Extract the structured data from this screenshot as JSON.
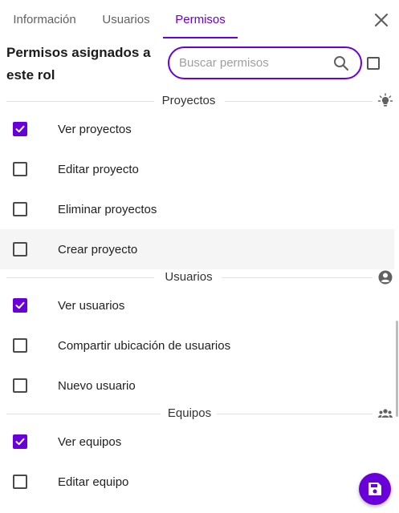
{
  "tabs": [
    {
      "label": "Información",
      "active": false
    },
    {
      "label": "Usuarios",
      "active": false
    },
    {
      "label": "Permisos",
      "active": true
    }
  ],
  "header": {
    "title": "Permisos asignados a este rol",
    "search_placeholder": "Buscar permisos",
    "search_value": ""
  },
  "sections": [
    {
      "label": "Proyectos",
      "icon": "lightbulb-icon",
      "items": [
        {
          "label": "Ver proyectos",
          "checked": true
        },
        {
          "label": "Editar proyecto",
          "checked": false
        },
        {
          "label": "Eliminar proyectos",
          "checked": false
        },
        {
          "label": "Crear proyecto",
          "checked": false
        }
      ]
    },
    {
      "label": "Usuarios",
      "icon": "user-circle-icon",
      "items": [
        {
          "label": "Ver usuarios",
          "checked": true
        },
        {
          "label": "Compartir ubicación de usuarios",
          "checked": false
        },
        {
          "label": "Nuevo usuario",
          "checked": false
        }
      ]
    },
    {
      "label": "Equipos",
      "icon": "group-icon",
      "items": [
        {
          "label": "Ver equipos",
          "checked": true
        },
        {
          "label": "Editar equipo",
          "checked": false
        }
      ]
    }
  ],
  "colors": {
    "accent": "#6a00d9",
    "hover_row": "#f5f5f5"
  }
}
